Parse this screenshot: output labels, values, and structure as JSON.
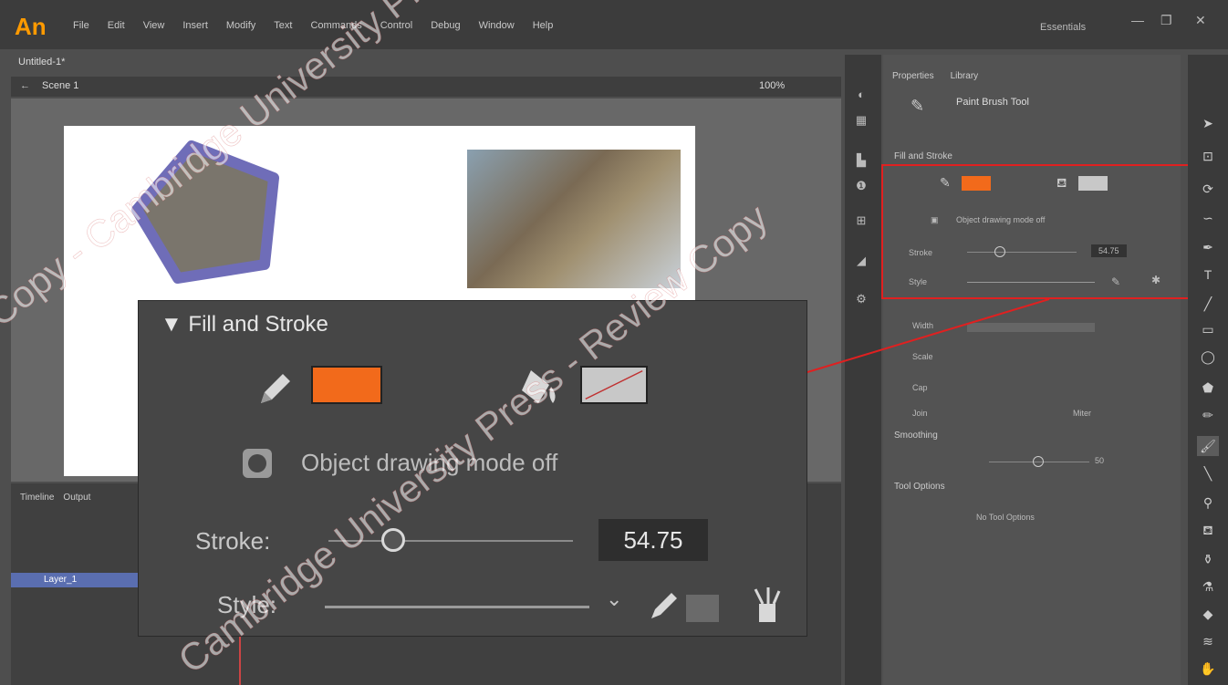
{
  "app": {
    "logo": "An",
    "menu": [
      "File",
      "Edit",
      "View",
      "Insert",
      "Modify",
      "Text",
      "Commands",
      "Control",
      "Debug",
      "Window",
      "Help"
    ],
    "workspace": "Essentials",
    "window_controls": [
      "—",
      "❐",
      "✕"
    ]
  },
  "document": {
    "tab": "Untitled-1*",
    "scene": "Scene 1",
    "zoom": "100%"
  },
  "timeline": {
    "tabs": [
      "Timeline",
      "Output"
    ],
    "layer_name": "Layer_1"
  },
  "properties": {
    "tabs": [
      "Properties",
      "Library"
    ],
    "tool_name": "Paint Brush Tool",
    "section_fill_stroke": "Fill and Stroke",
    "object_drawing": "Object drawing mode off",
    "stroke_label": "Stroke",
    "stroke_value": "54.75",
    "style_label": "Style",
    "width_label": "Width",
    "scale_label": "Scale",
    "cap_label": "Cap",
    "join_label": "Join",
    "join_value": "Miter",
    "section_smoothing": "Smoothing",
    "smoothing_value": "50",
    "section_tool_options": "Tool Options",
    "tool_options_value": "No Tool Options",
    "stroke_color": "#f26a1b",
    "fill_color": "#c8c8c8"
  },
  "zoomed": {
    "header": "Fill and Stroke",
    "object_drawing": "Object drawing mode off",
    "stroke_label": "Stroke:",
    "stroke_value": "54.75",
    "style_label": "Style:"
  },
  "watermark": {
    "line1": "Copy - Cambridge University Press - Review",
    "line2": "Cambridge University Press - Review Copy",
    "line3": "Cambridge University Press - Review Copy"
  }
}
